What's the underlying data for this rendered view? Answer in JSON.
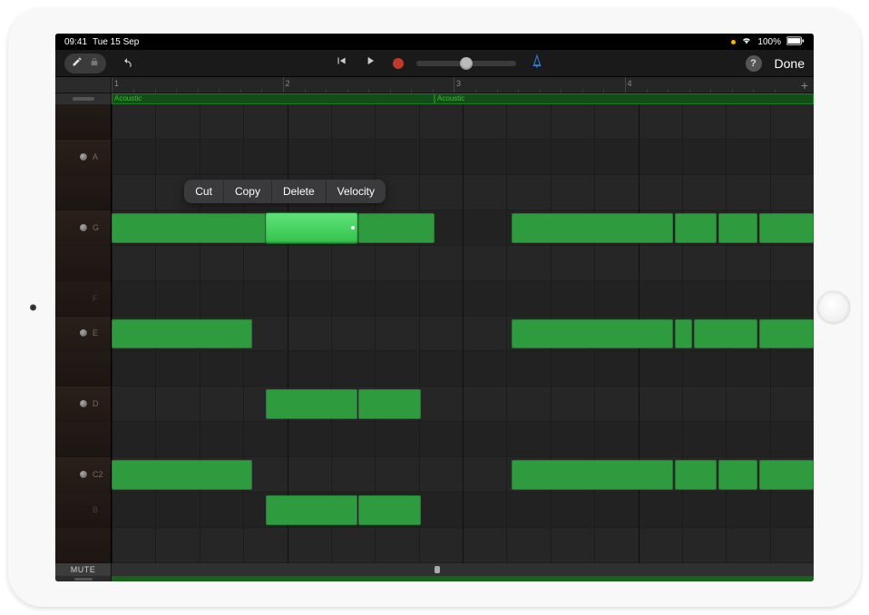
{
  "status": {
    "time": "09:41",
    "date": "Tue 15 Sep",
    "battery": "100%"
  },
  "toolbar": {
    "done_label": "Done"
  },
  "ruler": {
    "bars": [
      "1",
      "2",
      "3",
      "4"
    ]
  },
  "regions": [
    {
      "label": "Acoustic",
      "start_pct": 0,
      "width_pct": 46
    },
    {
      "label": "Acoustic",
      "start_pct": 46,
      "width_pct": 54
    }
  ],
  "context_menu": [
    "Cut",
    "Copy",
    "Delete",
    "Velocity"
  ],
  "pitch_rows": [
    {
      "label": "",
      "active": false
    },
    {
      "label": "A",
      "active": true
    },
    {
      "label": "",
      "active": false
    },
    {
      "label": "G",
      "active": true
    },
    {
      "label": "",
      "active": false
    },
    {
      "label": "F",
      "active": false
    },
    {
      "label": "E",
      "active": true
    },
    {
      "label": "",
      "active": false
    },
    {
      "label": "D",
      "active": true
    },
    {
      "label": "",
      "active": false
    },
    {
      "label": "C2",
      "active": true
    },
    {
      "label": "B",
      "active": false
    },
    {
      "label": "",
      "active": false
    }
  ],
  "notes": [
    {
      "row": 3,
      "start_pct": 0,
      "width_pct": 22,
      "selected": false
    },
    {
      "row": 3,
      "start_pct": 22,
      "width_pct": 13,
      "selected": true
    },
    {
      "row": 3,
      "start_pct": 35.2,
      "width_pct": 10.8,
      "selected": false
    },
    {
      "row": 3,
      "start_pct": 57,
      "width_pct": 23,
      "selected": false
    },
    {
      "row": 3,
      "start_pct": 80.2,
      "width_pct": 6,
      "selected": false
    },
    {
      "row": 3,
      "start_pct": 86.4,
      "width_pct": 5.6,
      "selected": false
    },
    {
      "row": 3,
      "start_pct": 92.2,
      "width_pct": 7.8,
      "selected": false
    },
    {
      "row": 6,
      "start_pct": 0,
      "width_pct": 20,
      "selected": false
    },
    {
      "row": 6,
      "start_pct": 57,
      "width_pct": 23,
      "selected": false
    },
    {
      "row": 6,
      "start_pct": 80.2,
      "width_pct": 2.5,
      "selected": false
    },
    {
      "row": 6,
      "start_pct": 82.9,
      "width_pct": 9.1,
      "selected": false
    },
    {
      "row": 6,
      "start_pct": 92.2,
      "width_pct": 7.8,
      "selected": false
    },
    {
      "row": 8,
      "start_pct": 22,
      "width_pct": 13,
      "selected": false
    },
    {
      "row": 8,
      "start_pct": 35.2,
      "width_pct": 8.8,
      "selected": false
    },
    {
      "row": 10,
      "start_pct": 0,
      "width_pct": 20,
      "selected": false
    },
    {
      "row": 10,
      "start_pct": 57,
      "width_pct": 23,
      "selected": false
    },
    {
      "row": 10,
      "start_pct": 80.2,
      "width_pct": 6,
      "selected": false
    },
    {
      "row": 10,
      "start_pct": 86.4,
      "width_pct": 5.6,
      "selected": false
    },
    {
      "row": 10,
      "start_pct": 92.2,
      "width_pct": 7.8,
      "selected": false
    },
    {
      "row": 11,
      "start_pct": 22,
      "width_pct": 13,
      "selected": false
    },
    {
      "row": 11,
      "start_pct": 35.2,
      "width_pct": 8.8,
      "selected": false
    }
  ],
  "bottom": {
    "mute_label": "MUTE",
    "scroll_thumb_pct": 46
  },
  "layout": {
    "grid_divisions": 16,
    "playhead_bar_pct": 22,
    "playhead_width_pct": 13
  }
}
